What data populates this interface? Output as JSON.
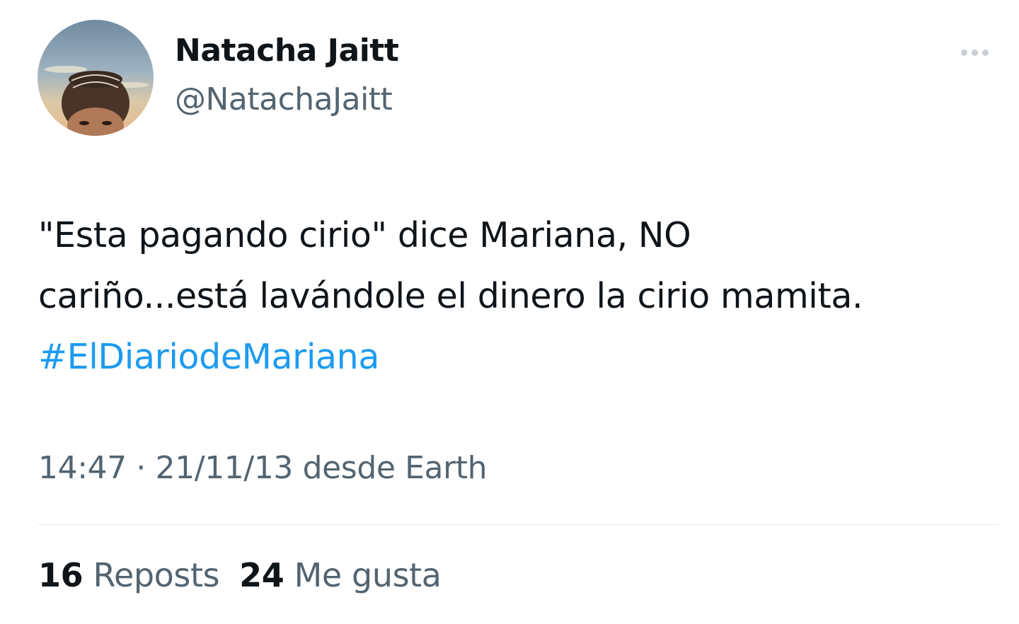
{
  "author": {
    "display_name": "Natacha Jaitt",
    "handle": "@NatachaJaitt"
  },
  "menu": {
    "icon": "more-horizontal-icon"
  },
  "tweet": {
    "text_line1": "\"Esta pagando cirio\" dice Mariana, NO",
    "text_line2": "cariño...está lavándole el dinero la cirio mamita.",
    "hashtag": "#ElDiariodeMariana"
  },
  "meta": {
    "time": "14:47",
    "separator": "·",
    "date": "21/11/13",
    "source": "desde Earth"
  },
  "stats": {
    "reposts_count": "16",
    "reposts_label": "Reposts",
    "likes_count": "24",
    "likes_label": "Me gusta"
  },
  "colors": {
    "text": "#0f1419",
    "secondary": "#536471",
    "link": "#1d9bf0",
    "divider": "#e3e7ea"
  }
}
